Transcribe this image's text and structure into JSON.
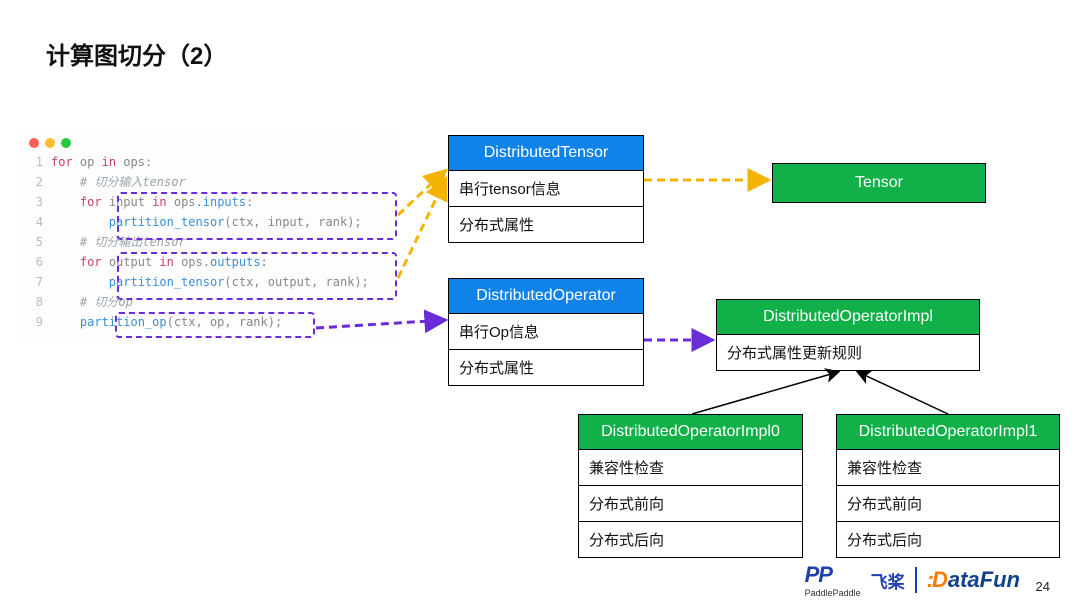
{
  "title": "计算图切分（2）",
  "page_number": "24",
  "code": {
    "l1": {
      "for": "for",
      "v": " op ",
      "in": "in",
      "rest": " ops:"
    },
    "l2": "# 切分输入tensor",
    "l3": {
      "for": "for",
      "v": " input ",
      "in": "in",
      "attr": " ops.",
      "attr2": "inputs",
      "rest": ":"
    },
    "l4": {
      "call": "partition_tensor",
      "args": "(ctx, input, rank);"
    },
    "l5": "# 切分输出tensor",
    "l6": {
      "for": "for",
      "v": " output ",
      "in": "in",
      "attr": " ops.",
      "attr2": "outputs",
      "rest": ":"
    },
    "l7": {
      "call": "partition_tensor",
      "args": "(ctx, output, rank);"
    },
    "l8": "# 切分op",
    "l9": {
      "call": "partition_op",
      "args": "(ctx, op, rank);"
    }
  },
  "boxes": {
    "dtensor": {
      "head": "DistributedTensor",
      "r1": "串行tensor信息",
      "r2": "分布式属性"
    },
    "tensor": {
      "head": "Tensor"
    },
    "dop": {
      "head": "DistributedOperator",
      "r1": "串行Op信息",
      "r2": "分布式属性"
    },
    "dopimpl": {
      "head": "DistributedOperatorImpl",
      "r1": "分布式属性更新规则"
    },
    "impl0": {
      "head": "DistributedOperatorImpl0",
      "r1": "兼容性检查",
      "r2": "分布式前向",
      "r3": "分布式后向"
    },
    "impl1": {
      "head": "DistributedOperatorImpl1",
      "r1": "兼容性检查",
      "r2": "分布式前向",
      "r3": "分布式后向"
    }
  },
  "logos": {
    "paddle": "PP",
    "paddle_sub": "PaddlePaddle",
    "feijiang": "飞桨",
    "datafun_pre": ":",
    "datafun_d": "D",
    "datafun_rest": "ataFun"
  }
}
